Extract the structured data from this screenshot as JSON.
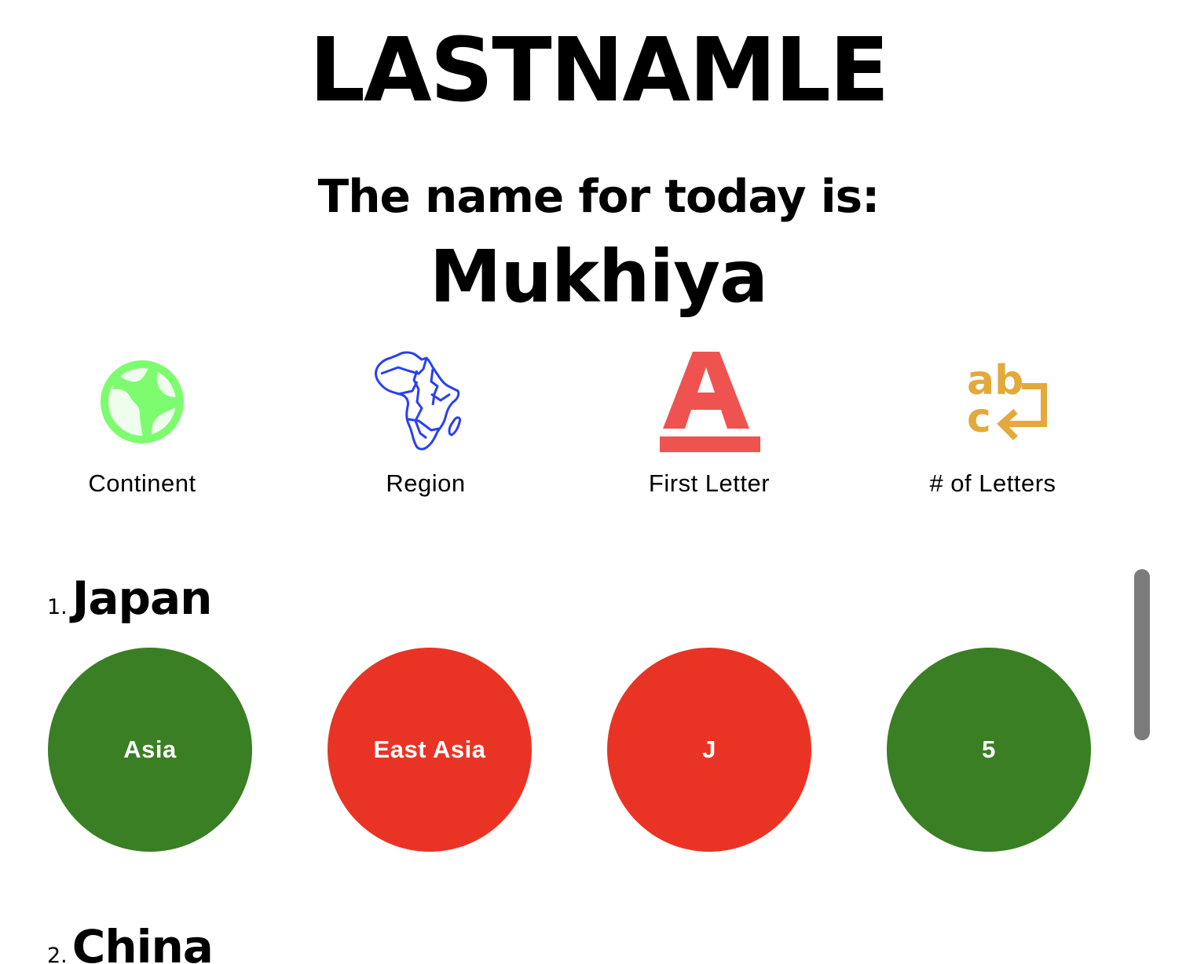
{
  "app": {
    "title": "LASTNAMLE",
    "subtitle": "The name for today is:",
    "name_of_the_day": "Mukhiya"
  },
  "categories": [
    {
      "label": "Continent",
      "icon": "globe-icon",
      "color": "#7dfc6f"
    },
    {
      "label": "Region",
      "icon": "africa-map-icon",
      "color": "#2a3ff0"
    },
    {
      "label": "First Letter",
      "icon": "letter-a-icon",
      "color": "#ef5350",
      "icon_text": "A"
    },
    {
      "label": "# of Letters",
      "icon": "abc-enter-icon",
      "color": "#e3a93b",
      "icon_text_1": "ab",
      "icon_text_2": "c"
    }
  ],
  "guesses": [
    {
      "number": "1.",
      "country": "Japan",
      "hints": [
        {
          "value": "Asia",
          "status": "correct",
          "color": "#3a7f23"
        },
        {
          "value": "East Asia",
          "status": "incorrect",
          "color": "#e93425"
        },
        {
          "value": "J",
          "status": "incorrect",
          "color": "#e93425"
        },
        {
          "value": "5",
          "status": "correct",
          "color": "#3a7f23"
        }
      ]
    },
    {
      "number": "2.",
      "country": "China",
      "hints": []
    }
  ]
}
